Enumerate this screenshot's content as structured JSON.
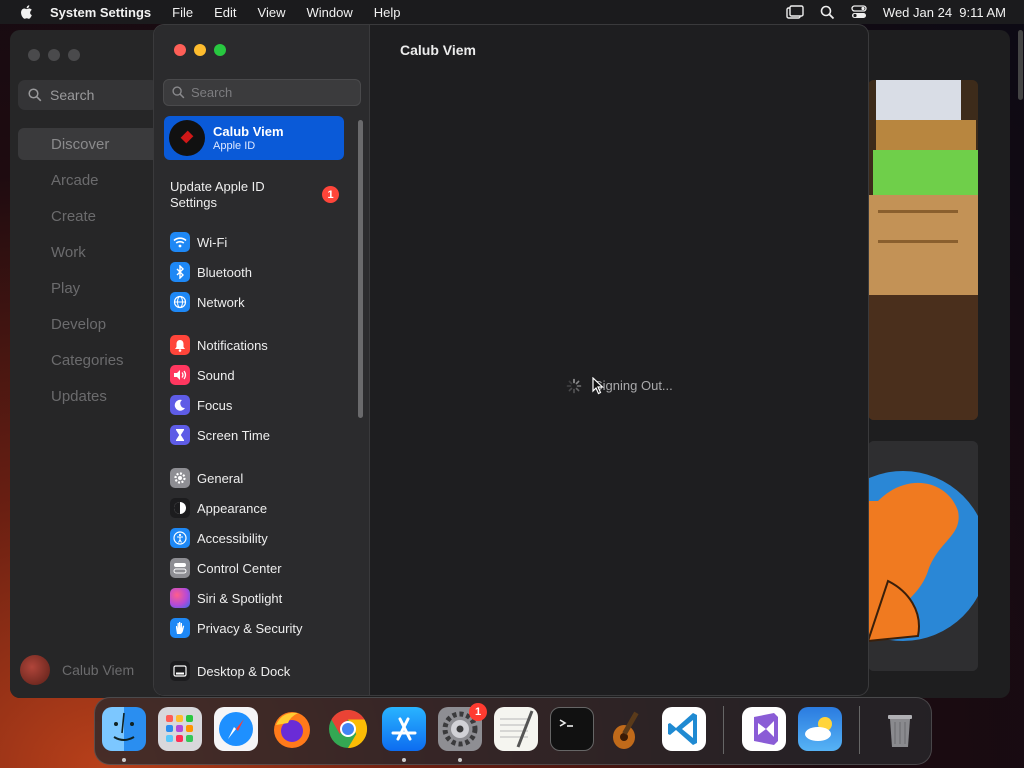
{
  "menubar": {
    "app_name": "System Settings",
    "items": [
      "File",
      "Edit",
      "View",
      "Window",
      "Help"
    ],
    "datetime": "Wed Jan 24  9:11 AM"
  },
  "appstore": {
    "search_placeholder": "Search",
    "nav": [
      "Discover",
      "Arcade",
      "Create",
      "Work",
      "Play",
      "Develop",
      "Categories",
      "Updates"
    ],
    "selected": "Discover",
    "user_name": "Calub Viem"
  },
  "settings": {
    "search_placeholder": "Search",
    "profile": {
      "name": "Calub Viem",
      "subtitle": "Apple ID"
    },
    "update": {
      "label": "Update Apple ID Settings",
      "badge": "1"
    },
    "items": [
      {
        "label": "Wi-Fi",
        "icon": "wifi-icon",
        "color": "#1e88f5"
      },
      {
        "label": "Bluetooth",
        "icon": "bluetooth-icon",
        "color": "#1e88f5"
      },
      {
        "label": "Network",
        "icon": "globe-icon",
        "color": "#1e88f5"
      },
      {
        "label": "Notifications",
        "icon": "bell-icon",
        "color": "#ff453a"
      },
      {
        "label": "Sound",
        "icon": "speaker-icon",
        "color": "#ff375f"
      },
      {
        "label": "Focus",
        "icon": "moon-icon",
        "color": "#5e5ce6"
      },
      {
        "label": "Screen Time",
        "icon": "hourglass-icon",
        "color": "#5e5ce6"
      },
      {
        "label": "General",
        "icon": "gear-icon",
        "color": "#8e8e93"
      },
      {
        "label": "Appearance",
        "icon": "appearance-icon",
        "color": "#1c1c1e"
      },
      {
        "label": "Accessibility",
        "icon": "accessibility-icon",
        "color": "#1e88f5"
      },
      {
        "label": "Control Center",
        "icon": "control-center-icon",
        "color": "#8e8e93"
      },
      {
        "label": "Siri & Spotlight",
        "icon": "siri-icon",
        "color": "#b44ad8"
      },
      {
        "label": "Privacy & Security",
        "icon": "hand-icon",
        "color": "#1e88f5"
      },
      {
        "label": "Desktop & Dock",
        "icon": "dock-icon",
        "color": "#1c1c1e"
      }
    ],
    "page_title": "Calub Viem",
    "status": "Signing Out..."
  },
  "dock": {
    "apps": [
      "Finder",
      "Launchpad",
      "Safari",
      "Firefox",
      "Chrome",
      "App Store",
      "System Settings",
      "TextEdit",
      "Terminal",
      "GarageBand",
      "Visual Studio Code",
      "Visual Studio",
      "Weather",
      "Trash"
    ],
    "system_settings_badge": "1"
  }
}
